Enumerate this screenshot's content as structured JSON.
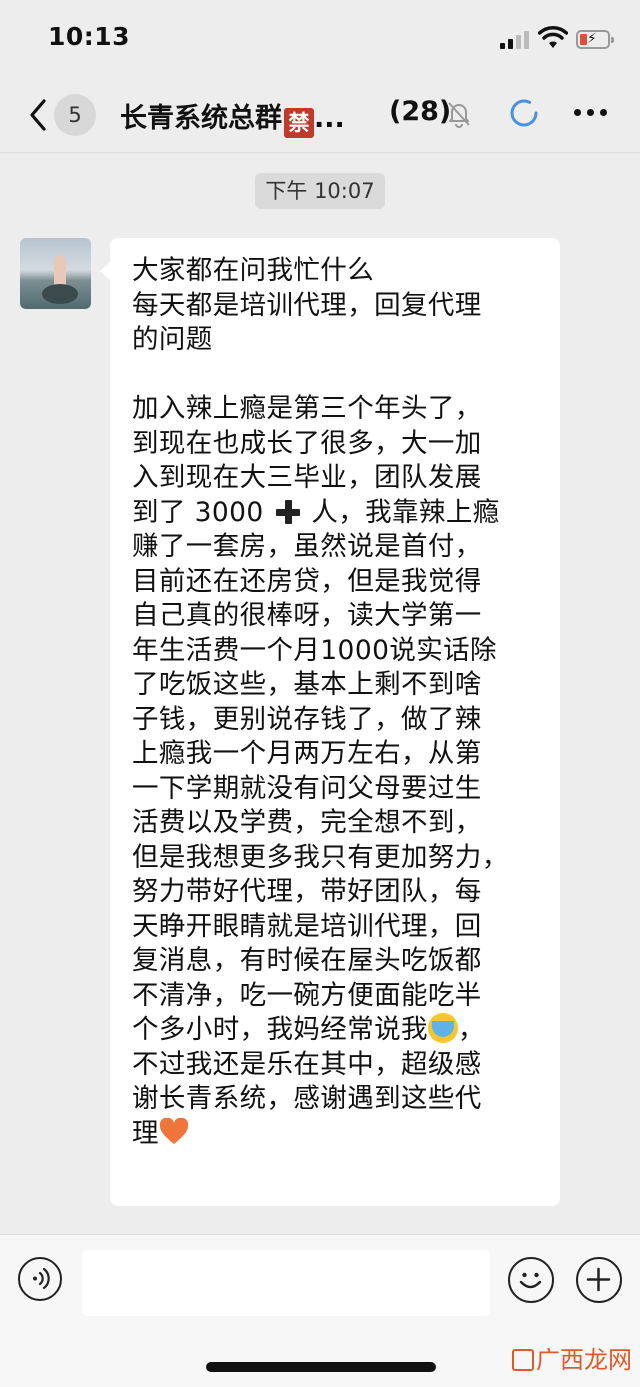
{
  "status_bar": {
    "time": "10:13"
  },
  "header": {
    "unread_count": "5",
    "title": "长青系统总群",
    "ban_badge": "禁",
    "ellipsis": "...",
    "member_count": "(28)"
  },
  "chat": {
    "timestamp": "下午 10:07",
    "message": {
      "lines": [
        "大家都在问我忙什么",
        "每天都是培训代理，回复代理",
        "的问题",
        "",
        "加入辣上瘾是第三个年头了，",
        "到现在也成长了很多，大一加",
        "入到现在大三毕业，团队发展",
        "到了 3000",
        "人，我靠辣上瘾",
        "赚了一套房，虽然说是首付，",
        "目前还在还房贷，但是我觉得",
        "自己真的很棒呀，读大学第一",
        "年生活费一个月1000说实话除",
        "了吃饭这些，基本上剩不到啥",
        "子钱，更别说存钱了，做了辣",
        "上瘾我一个月两万左右，从第",
        "一下学期就没有问父母要过生",
        "活费以及学费，完全想不到，",
        "但是我想更多我只有更加努力，",
        "努力带好代理，带好团队，每",
        "天睁开眼睛就是培训代理，回",
        "复消息，有时候在屋头吃饭都",
        "不清净，吃一碗方便面能吃半",
        "个多小时，我妈经常说我",
        "，",
        "不过我还是乐在其中，超级感",
        "谢长青系统，感谢遇到这些代",
        "理"
      ]
    }
  },
  "emojis": {
    "plus": "heavy-plus-emoji",
    "cry": "loudly-crying-face-emoji",
    "heart": "orange-heart-emoji"
  },
  "watermark": {
    "text": "广西龙网"
  },
  "colors": {
    "background": "#ededed",
    "bubble": "#ffffff",
    "ban_badge": "#c0392b",
    "loading": "#4a90e2",
    "heart": "#f0753a"
  }
}
